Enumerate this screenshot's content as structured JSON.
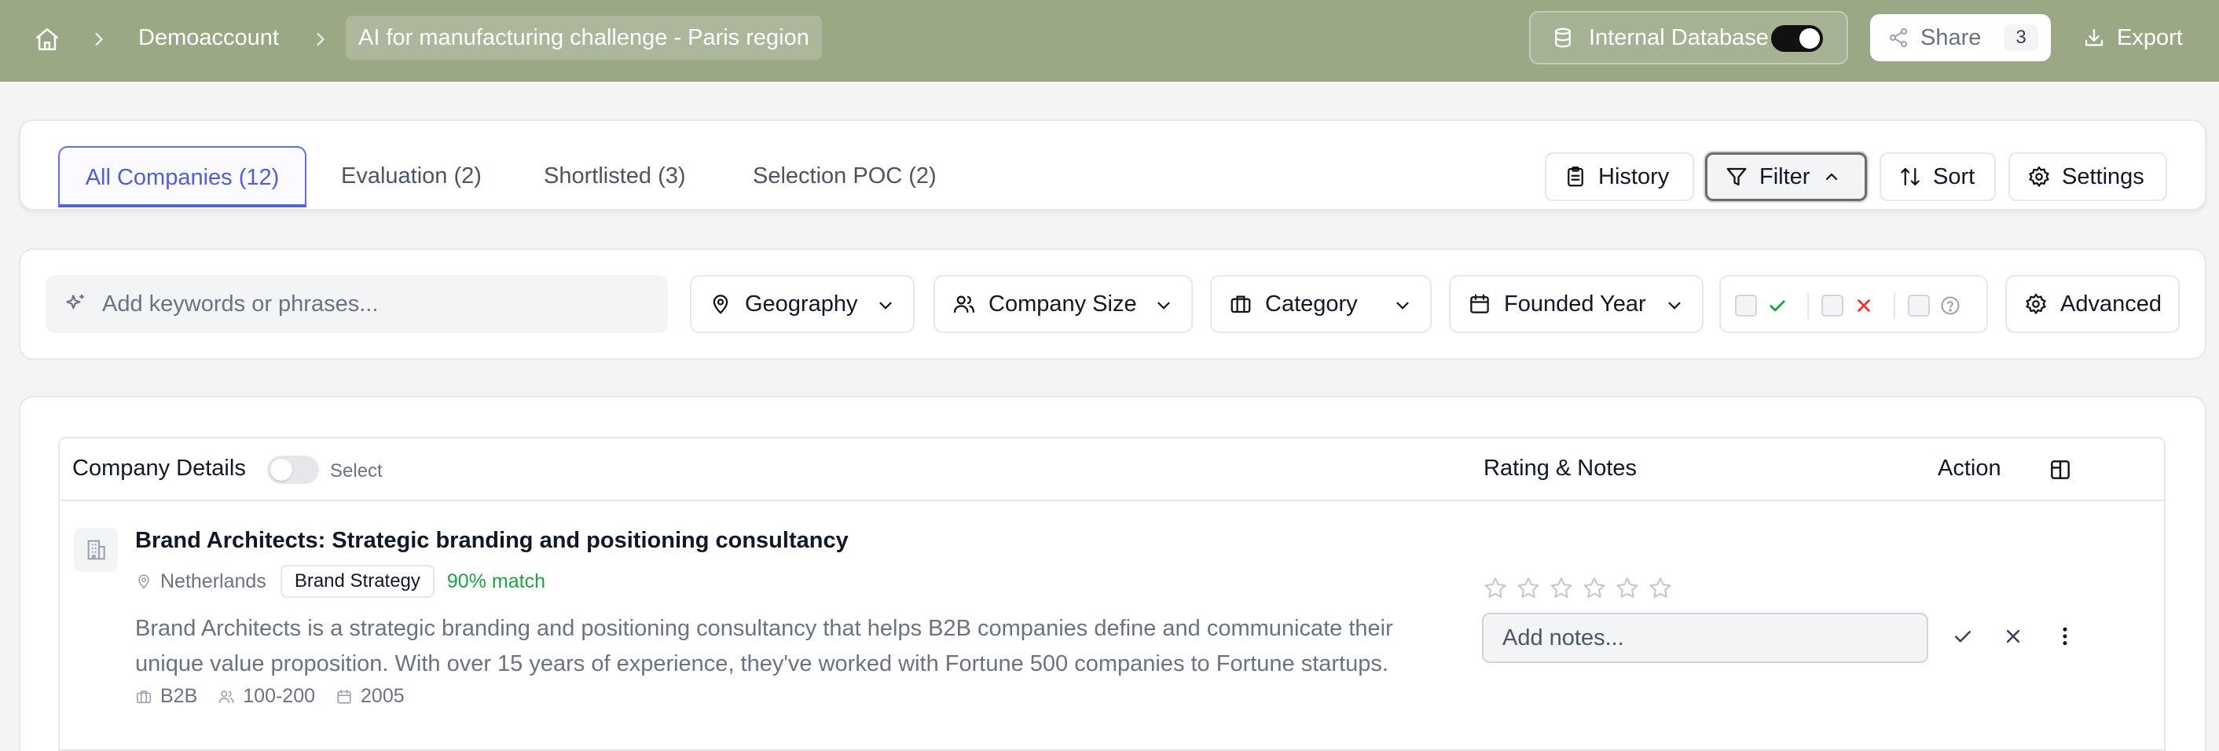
{
  "topbar": {
    "breadcrumb": [
      "Demoaccount",
      "AI for manufacturing challenge - Paris region"
    ],
    "internal_db_label": "Internal Database",
    "internal_db_enabled": true,
    "share_label": "Share",
    "share_count": "3",
    "export_label": "Export",
    "background_color": "#9aa886"
  },
  "tabs": [
    {
      "label": "All Companies (12)",
      "active": true
    },
    {
      "label": "Evaluation (2)",
      "active": false
    },
    {
      "label": "Shortlisted (3)",
      "active": false
    },
    {
      "label": "Selection POC (2)",
      "active": false
    }
  ],
  "toolbar": {
    "history": "History",
    "filter": "Filter",
    "sort": "Sort",
    "settings": "Settings"
  },
  "filters": {
    "keyword_placeholder": "Add keywords or phrases...",
    "geography": "Geography",
    "company_size": "Company Size",
    "category": "Category",
    "founded_year": "Founded Year",
    "advanced": "Advanced"
  },
  "table": {
    "col_company": "Company Details",
    "select_label": "Select",
    "col_rating": "Rating & Notes",
    "col_action": "Action",
    "rows": [
      {
        "name": "Brand Architects: Strategic branding and positioning consultancy",
        "location": "Netherlands",
        "tag": "Brand Strategy",
        "match": "90% match",
        "description_line1": "Brand Architects is a strategic branding and positioning consultancy that helps B2B companies define and communicate their",
        "description_line2": "unique value proposition. With over 15 years of experience, they've worked with Fortune 500 companies to Fortune startups.",
        "business_model": "B2B",
        "employees": "100-200",
        "founded": "2005",
        "rating": 0,
        "notes_placeholder": "Add notes..."
      }
    ]
  },
  "colors": {
    "accent": "#5563dd",
    "match_green": "#22a045",
    "reject_red": "#e53935"
  }
}
